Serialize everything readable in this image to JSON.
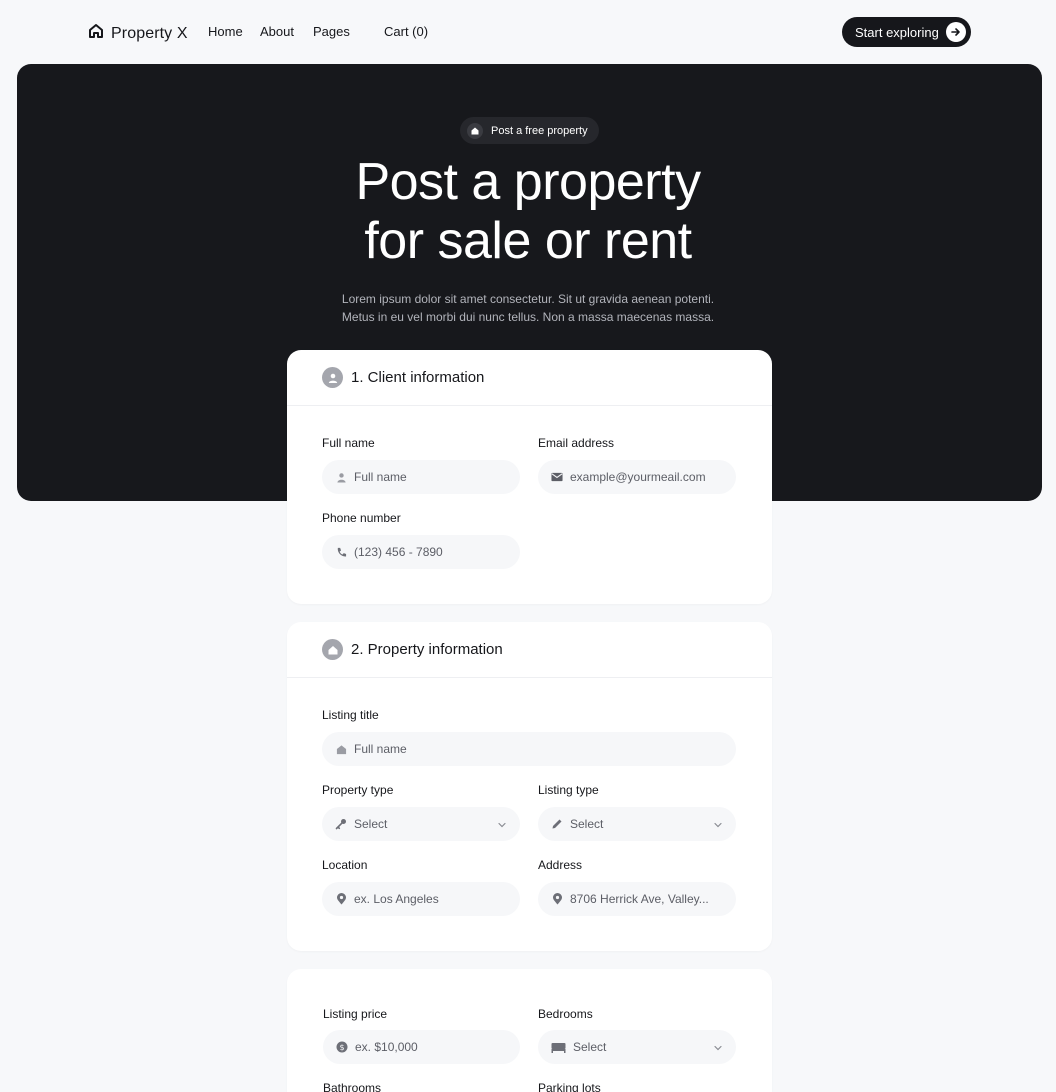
{
  "nav": {
    "logo_text": "Property X",
    "links": [
      "Home",
      "About",
      "Pages"
    ],
    "cart": "Cart (0)",
    "cta": "Start exploring"
  },
  "hero": {
    "badge": "Post a free property",
    "title_line1": "Post a property",
    "title_line2": "for sale or rent",
    "subtitle_line1": "Lorem ipsum dolor sit amet consectetur. Sit ut gravida aenean potenti.",
    "subtitle_line2": "Metus in eu vel morbi dui nunc tellus. Non a massa maecenas massa."
  },
  "client": {
    "title": "1. Client information",
    "full_name_label": "Full name",
    "full_name_placeholder": "Full name",
    "email_label": "Email address",
    "email_placeholder": "example@yourmeail.com",
    "phone_label": "Phone number",
    "phone_placeholder": "(123) 456 - 7890"
  },
  "property": {
    "title": "2. Property information",
    "listing_title_label": "Listing title",
    "listing_title_placeholder": "Full name",
    "property_type_label": "Property type",
    "property_type_value": "Select",
    "listing_type_label": "Listing type",
    "listing_type_value": "Select",
    "location_label": "Location",
    "location_placeholder": "ex. Los Angeles",
    "address_label": "Address",
    "address_placeholder": "8706 Herrick Ave, Valley..."
  },
  "details": {
    "price_label": "Listing price",
    "price_placeholder": "ex. $10,000",
    "bedrooms_label": "Bedrooms",
    "bedrooms_value": "Select",
    "bathrooms_label": "Bathrooms",
    "parking_label": "Parking lots"
  },
  "colors": {
    "dark": "#17181c",
    "page_bg": "#f7f8fa",
    "field_bg": "#f6f7f9"
  }
}
